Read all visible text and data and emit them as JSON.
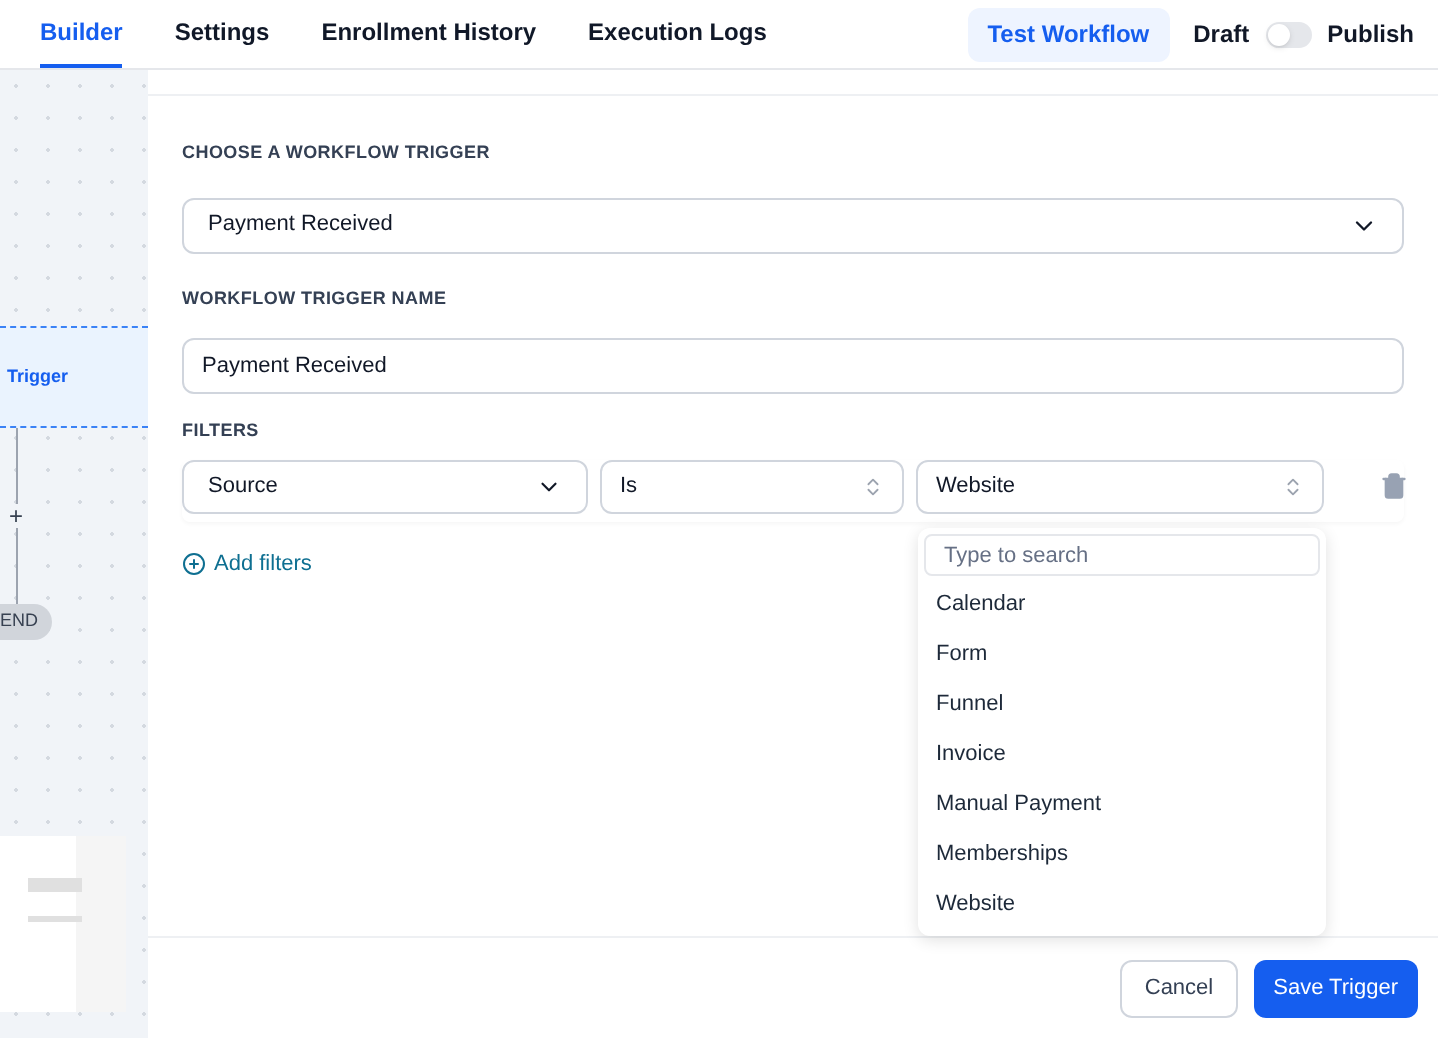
{
  "tabs": [
    {
      "label": "Builder",
      "selected": true
    },
    {
      "label": "Settings",
      "selected": false
    },
    {
      "label": "Enrollment History",
      "selected": false
    },
    {
      "label": "Execution Logs",
      "selected": false
    }
  ],
  "header": {
    "test_button": "Test Workflow",
    "draft_label": "Draft",
    "publish_on": false,
    "publish_label": "Publish"
  },
  "canvas": {
    "trigger_node": "Trigger",
    "end_node": "END",
    "add_symbol": "+"
  },
  "form": {
    "trigger_label": "CHOOSE A WORKFLOW TRIGGER",
    "trigger_value": "Payment Received",
    "name_label": "WORKFLOW TRIGGER NAME",
    "name_value": "Payment Received",
    "filters_label": "FILTERS",
    "filter": {
      "field": "Source",
      "operator": "Is",
      "value": "Website"
    },
    "add_filters": "Add filters"
  },
  "dropdown": {
    "placeholder": "Type to search",
    "options": [
      {
        "label": "Calendar",
        "selected": false
      },
      {
        "label": "Form",
        "selected": false
      },
      {
        "label": "Funnel",
        "selected": false
      },
      {
        "label": "Invoice",
        "selected": false
      },
      {
        "label": "Manual Payment",
        "selected": false
      },
      {
        "label": "Memberships",
        "selected": false
      },
      {
        "label": "Website",
        "selected": false
      }
    ]
  },
  "footer": {
    "cancel": "Cancel",
    "save": "Save Trigger"
  }
}
